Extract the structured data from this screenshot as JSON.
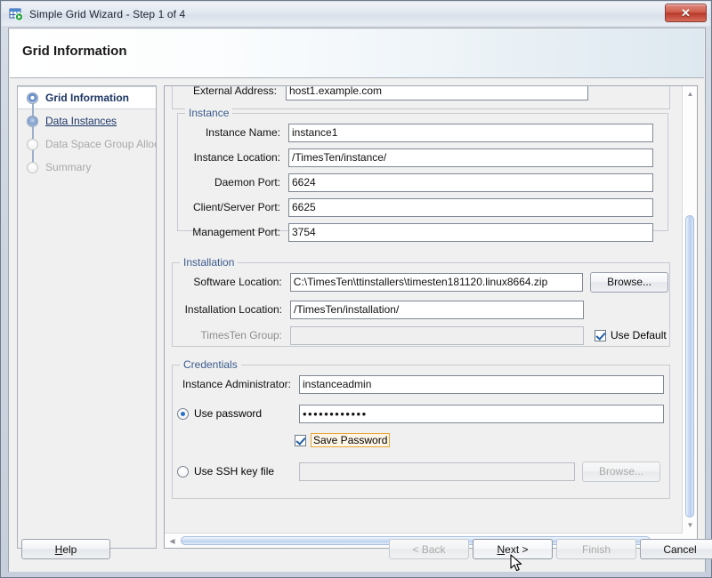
{
  "window": {
    "title": "Simple Grid Wizard - Step 1 of 4",
    "icon": "grid-run-icon",
    "close_label": "✕"
  },
  "header": {
    "title": "Grid Information"
  },
  "sidebar": {
    "items": [
      {
        "label": "Grid Information",
        "state": "current"
      },
      {
        "label": "Data Instances",
        "state": "link"
      },
      {
        "label": "Data Space Group Alloca",
        "state": "disabled"
      },
      {
        "label": "Summary",
        "state": "disabled"
      }
    ]
  },
  "form": {
    "clipped_top_row": {
      "label": "External Address:",
      "value": "host1.example.com"
    },
    "instance": {
      "legend": "Instance",
      "fields": [
        {
          "label": "Instance Name:",
          "value": "instance1"
        },
        {
          "label": "Instance Location:",
          "value": "/TimesTen/instance/"
        },
        {
          "label": "Daemon Port:",
          "value": "6624"
        },
        {
          "label": "Client/Server Port:",
          "value": "6625"
        },
        {
          "label": "Management Port:",
          "value": "3754"
        }
      ]
    },
    "installation": {
      "legend": "Installation",
      "software_location": {
        "label": "Software Location:",
        "value": "C:\\TimesTen\\ttinstallers\\timesten181120.linux8664.zip"
      },
      "software_browse_label": "Browse...",
      "installation_location": {
        "label": "Installation Location:",
        "value": "/TimesTen/installation/"
      },
      "timesten_group": {
        "label": "TimesTen Group:",
        "value": ""
      },
      "use_default": {
        "label": "Use Default",
        "checked": true
      }
    },
    "credentials": {
      "legend": "Credentials",
      "instance_administrator": {
        "label": "Instance Administrator:",
        "value": "instanceadmin"
      },
      "use_password": {
        "label": "Use password",
        "selected": true,
        "value": "••••••••••••"
      },
      "save_password": {
        "label": "Save Password",
        "checked": true,
        "focused": true
      },
      "use_ssh_key": {
        "label": "Use SSH key file",
        "selected": false,
        "value": ""
      },
      "ssh_browse_label": "Browse..."
    }
  },
  "buttons": {
    "help": {
      "label": "Help",
      "enabled": true,
      "mnemonic": "H"
    },
    "back": {
      "label": "< Back",
      "enabled": false,
      "mnemonic": "B"
    },
    "next": {
      "label": "Next >",
      "enabled": true,
      "mnemonic": "N",
      "hovered": true
    },
    "finish": {
      "label": "Finish",
      "enabled": false,
      "mnemonic": "F"
    },
    "cancel": {
      "label": "Cancel",
      "enabled": true,
      "mnemonic": ""
    }
  },
  "colors": {
    "legend": "#3a5b8c",
    "link": "#1c3567",
    "focus_ring": "#e9a43a",
    "close_button": "#b8382a",
    "scroll_thumb": "#bed2ef"
  }
}
